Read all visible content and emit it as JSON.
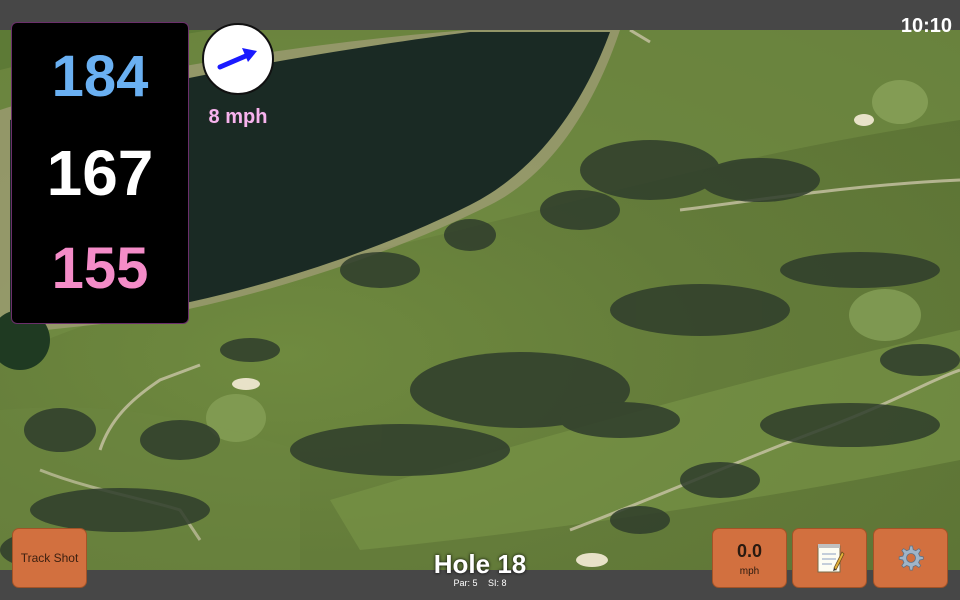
{
  "status": {
    "time": "10:10"
  },
  "distances": {
    "back": "184",
    "middle": "167",
    "front": "155"
  },
  "wind": {
    "speed_label": "8 mph",
    "arrow_color": "#1a1aff"
  },
  "hole": {
    "title": "Hole 18",
    "par_label": "Par: 5",
    "si_label": "SI: 8"
  },
  "buttons": {
    "track_shot": "Track Shot",
    "speed_value": "0.0",
    "speed_unit": "mph",
    "notes_icon": "notepad-icon",
    "settings_icon": "gear-icon"
  },
  "colors": {
    "back_distance": "#6ab0f2",
    "middle_distance": "#ffffff",
    "front_distance": "#f48cc8",
    "button_bg": "#d2703f"
  }
}
